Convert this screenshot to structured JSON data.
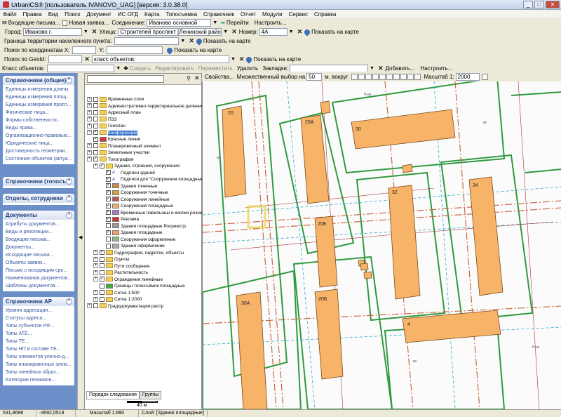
{
  "window": {
    "title": "UrbaniCS® [пользователь IVANOVO_UAG] [версия: 3.0.38.0]"
  },
  "menu": [
    "Файл",
    "Правка",
    "Вид",
    "Поиск",
    "Документ",
    "ИС ОГД",
    "Карта",
    "Топосъемка",
    "Справочник",
    "Отчет",
    "Модули",
    "Сервис",
    "Справка"
  ],
  "toolbar1": {
    "incoming": "Входящие письма...",
    "new_request": "Новая заявка...",
    "connection_label": "Соединение:",
    "connection_value": "Иваново основной",
    "go": "Перейти",
    "settings": "Настроить..."
  },
  "toolbar2": {
    "city_label": "Город:",
    "city_value": "Иваново г.",
    "street_label": "Улица:",
    "street_value": "Строителей проспект [Ленинский район]",
    "number_label": "Номер:",
    "number_value": "4А",
    "show_map": "Показать на карте"
  },
  "toolbar3": {
    "border_label": "Граница территории населенного пункта:",
    "show_map": "Показать на карте"
  },
  "toolbar4": {
    "coords_label": "Поиск по координатам X:",
    "y_label": "Y:",
    "show_map": "Показать на карте"
  },
  "toolbar5": {
    "geoid_label": "Поиск по GeoId:",
    "class_value": "класс объектов:",
    "show_map": "Показать на карте"
  },
  "toolbar6": {
    "class_label": "Класс объектов:",
    "create": "Создать",
    "edit": "Редактировать",
    "move": "Переместить",
    "delete": "Удалить",
    "bookmarks": "Закладки:",
    "add": "Добавить...",
    "settings": "Настроить..."
  },
  "sidebar": [
    {
      "title": "Справочники (общие)",
      "items": [
        "Единицы измерения длины",
        "Единицы измерения площ...",
        "Единицы измерения просп...",
        "Физические лица...",
        "Формы собственности...",
        "Виды права...",
        "Организационно-правовые...",
        "Юридические лица...",
        "Достоверность геометрии...",
        "Состояния объектов (актуа..."
      ]
    },
    {
      "title": "Справочники (топосъе",
      "items": []
    },
    {
      "title": "Отделы, сотрудники",
      "items": []
    },
    {
      "title": "Документы",
      "items": [
        "Атрибуты документов...",
        "Виды и резолюции...",
        "Входящие письма...",
        "Документы...",
        "Исходящие письма...",
        "Объекты заявок...",
        "Письмо с исходящим сро...",
        "Наименования документов...",
        "Шаблоны документов..."
      ]
    },
    {
      "title": "Справочники АР",
      "items": [
        "Уровни адресации...",
        "Статусы адреса...",
        "Типы субъектов РФ...",
        "Типы АТЕ...",
        "Типы ТЕ...",
        "Типы НП в составе ТЕ...",
        "Типы элементов улично-д...",
        "Типы планировочных элем...",
        "Типы линейных образ...",
        "Категории геонимов..."
      ]
    }
  ],
  "layers_toolbar": {
    "properties": "Свойства...",
    "multi_select": "Множественный выбор на",
    "multi_value": "50",
    "around": "м. вокруг",
    "scale_label": "Масштаб 1:",
    "scale_value": "2000"
  },
  "tree": [
    {
      "lvl": 0,
      "t": "Временные слои",
      "k": "f",
      "c": false
    },
    {
      "lvl": 0,
      "t": "Административно-территориальное деление",
      "k": "f",
      "c": false
    },
    {
      "lvl": 0,
      "t": "Адресный план",
      "k": "f",
      "c": false
    },
    {
      "lvl": 0,
      "t": "ПЗЗ",
      "k": "f",
      "c": false
    },
    {
      "lvl": 0,
      "t": "Генплан",
      "k": "f",
      "c": false
    },
    {
      "lvl": 0,
      "t": "Конференция",
      "k": "f",
      "c": true,
      "sel": true
    },
    {
      "lvl": 0,
      "t": "Красные линии",
      "k": "l",
      "c": true,
      "col": "#d33"
    },
    {
      "lvl": 0,
      "t": "Планировочный элемент",
      "k": "f",
      "c": false
    },
    {
      "lvl": 0,
      "t": "Земельные участки",
      "k": "f",
      "c": false
    },
    {
      "lvl": 0,
      "t": "Топография",
      "k": "f",
      "c": true
    },
    {
      "lvl": 1,
      "t": "Здания, строения, сооружения",
      "k": "f",
      "c": true
    },
    {
      "lvl": 2,
      "t": "Подписи зданий",
      "k": "t",
      "c": true
    },
    {
      "lvl": 2,
      "t": "Подписи для \"Сооружения площадные\"",
      "k": "t",
      "c": true
    },
    {
      "lvl": 2,
      "t": "Здания точечные",
      "k": "l",
      "c": true,
      "col": "#c84"
    },
    {
      "lvl": 2,
      "t": "Сооружения точечные",
      "k": "l",
      "c": true,
      "col": "#d6a040"
    },
    {
      "lvl": 2,
      "t": "Сооружения линейные",
      "k": "l",
      "c": true,
      "col": "#b55"
    },
    {
      "lvl": 2,
      "t": "Сооружения площадные",
      "k": "l",
      "c": true,
      "col": "#e8b06a"
    },
    {
      "lvl": 2,
      "t": "Временные павильоны и киоски розни",
      "k": "l",
      "c": true,
      "col": "#a7c"
    },
    {
      "lvl": 2,
      "t": "Реклама",
      "k": "l",
      "c": true,
      "col": "#c33"
    },
    {
      "lvl": 2,
      "t": "Здания площадные Росреестр",
      "k": "l",
      "c": false,
      "col": "#999"
    },
    {
      "lvl": 2,
      "t": "Здания площадные",
      "k": "l",
      "c": true,
      "col": "#f0a060"
    },
    {
      "lvl": 2,
      "t": "Сооружения оформление",
      "k": "l",
      "c": false,
      "col": "#8b8"
    },
    {
      "lvl": 2,
      "t": "Здания оформление",
      "k": "l",
      "c": false,
      "col": "#aaa"
    },
    {
      "lvl": 1,
      "t": "Гидрография, гидротех. объекты",
      "k": "f",
      "c": true
    },
    {
      "lvl": 1,
      "t": "Грунты",
      "k": "f",
      "c": false
    },
    {
      "lvl": 1,
      "t": "Пути сообщения",
      "k": "f",
      "c": false
    },
    {
      "lvl": 1,
      "t": "Растительность",
      "k": "f",
      "c": false
    },
    {
      "lvl": 1,
      "t": "Ограждения линейные",
      "k": "f",
      "c": true
    },
    {
      "lvl": 1,
      "t": "Границы топосъёмок площадные",
      "k": "l",
      "c": false,
      "col": "#4a4"
    },
    {
      "lvl": 1,
      "t": "Сетка 1:500",
      "k": "f",
      "c": false
    },
    {
      "lvl": 1,
      "t": "Сетка 1:2000",
      "k": "f",
      "c": false
    },
    {
      "lvl": 0,
      "t": "Градодокументация растр",
      "k": "f",
      "c": false
    }
  ],
  "tabs": [
    "Порядок следования",
    "Группы"
  ],
  "scale_bar": "40 м",
  "buildings": [
    "20",
    "20А",
    "30",
    "32",
    "34",
    "20Б",
    "20Б",
    "30А",
    "4"
  ],
  "status": {
    "x": "531,8698",
    "y": "-3692,0518",
    "scale": "Масштаб 1:890",
    "layer": "Слой: [Здания площадные]"
  }
}
